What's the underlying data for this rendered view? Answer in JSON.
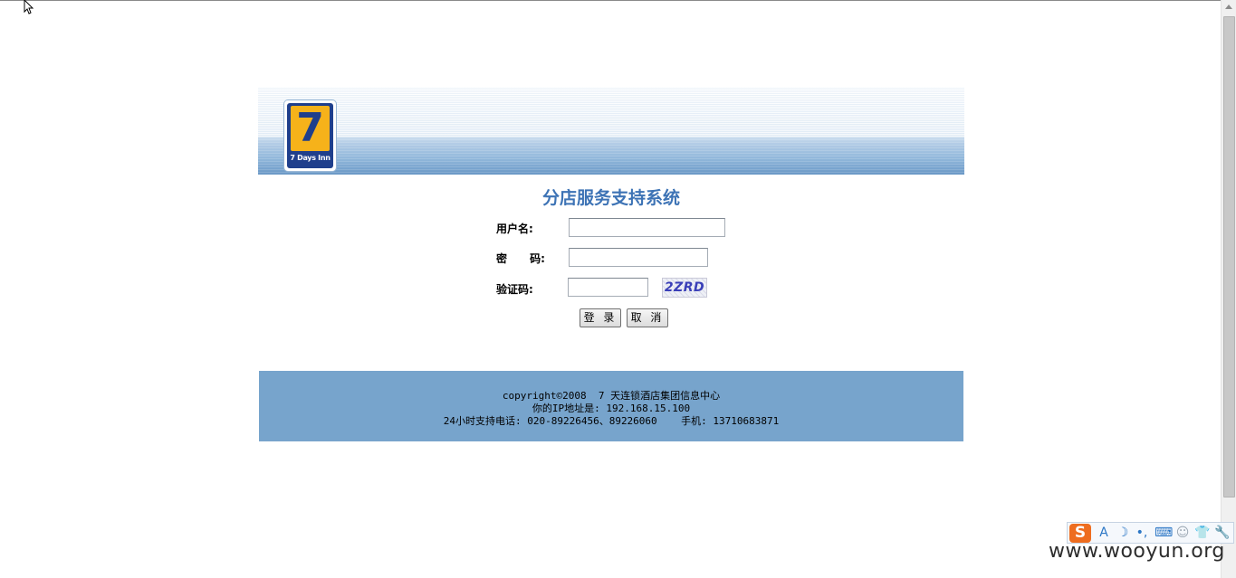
{
  "header": {
    "logo_text": "7 Days Inn",
    "system_title": "分店服务支持系统"
  },
  "form": {
    "username_label": "用户名:",
    "username_value": "",
    "password_label": "密      码:",
    "password_value": "",
    "captcha_label": "验证码:",
    "captcha_value": "",
    "captcha_image_text": "2ZRD",
    "login_button": "登 录",
    "cancel_button": "取 消"
  },
  "footer": {
    "copyright": "copyright©2008  7 天连锁酒店集团信息中心",
    "ip_line": "你的IP地址是: 192.168.15.100",
    "support_line": "24小时支持电话: 020-89226456、89226060    手机: 13710683871"
  },
  "ime_toolbar": {
    "logo": "S",
    "items": [
      "A",
      "☽",
      "•,",
      "⌨",
      "☺",
      "👕",
      "🔧"
    ]
  },
  "watermark": "www.wooyun.org",
  "colors": {
    "title_blue": "#3d73b5",
    "footer_bg": "#77a4cc",
    "logo_yellow": "#f6b21a",
    "logo_navy": "#1f3f8c"
  }
}
